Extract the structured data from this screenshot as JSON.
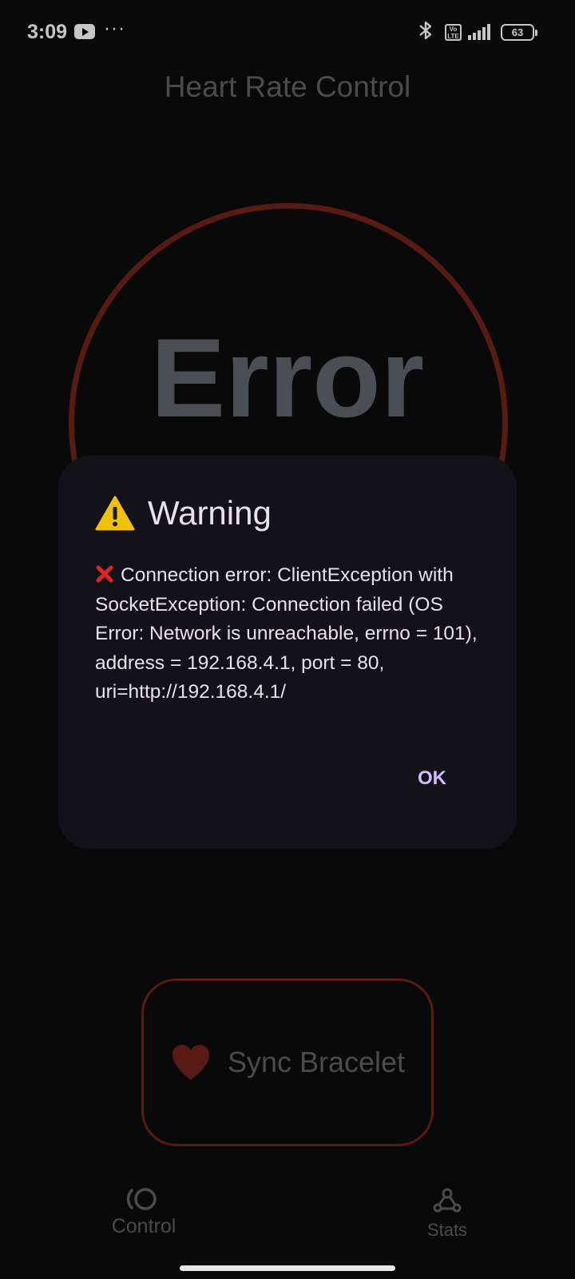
{
  "status_bar": {
    "time": "3:09",
    "volte_label": "Vo LTE",
    "battery": "63"
  },
  "app": {
    "title": "Heart Rate Control",
    "status_text": "Error",
    "ring_color": "#6b2219"
  },
  "dialog": {
    "title": "Warning",
    "icon": "warning-icon",
    "message_prefix_icon": "cross-mark-icon",
    "message": "Connection error: ClientException with SocketException: Connection failed (OS Error: Network is unreachable, errno = 101), address = 192.168.4.1, port = 80, uri=http://192.168.4.1/",
    "ok_label": "OK",
    "accent_color": "#d3bcfd"
  },
  "sync_button": {
    "label": "Sync Bracelet",
    "icon": "heart-icon"
  },
  "bottom_nav": {
    "items": [
      {
        "label": "Control",
        "icon": "control-icon"
      },
      {
        "label": "Stats",
        "icon": "webhook-icon"
      }
    ]
  }
}
